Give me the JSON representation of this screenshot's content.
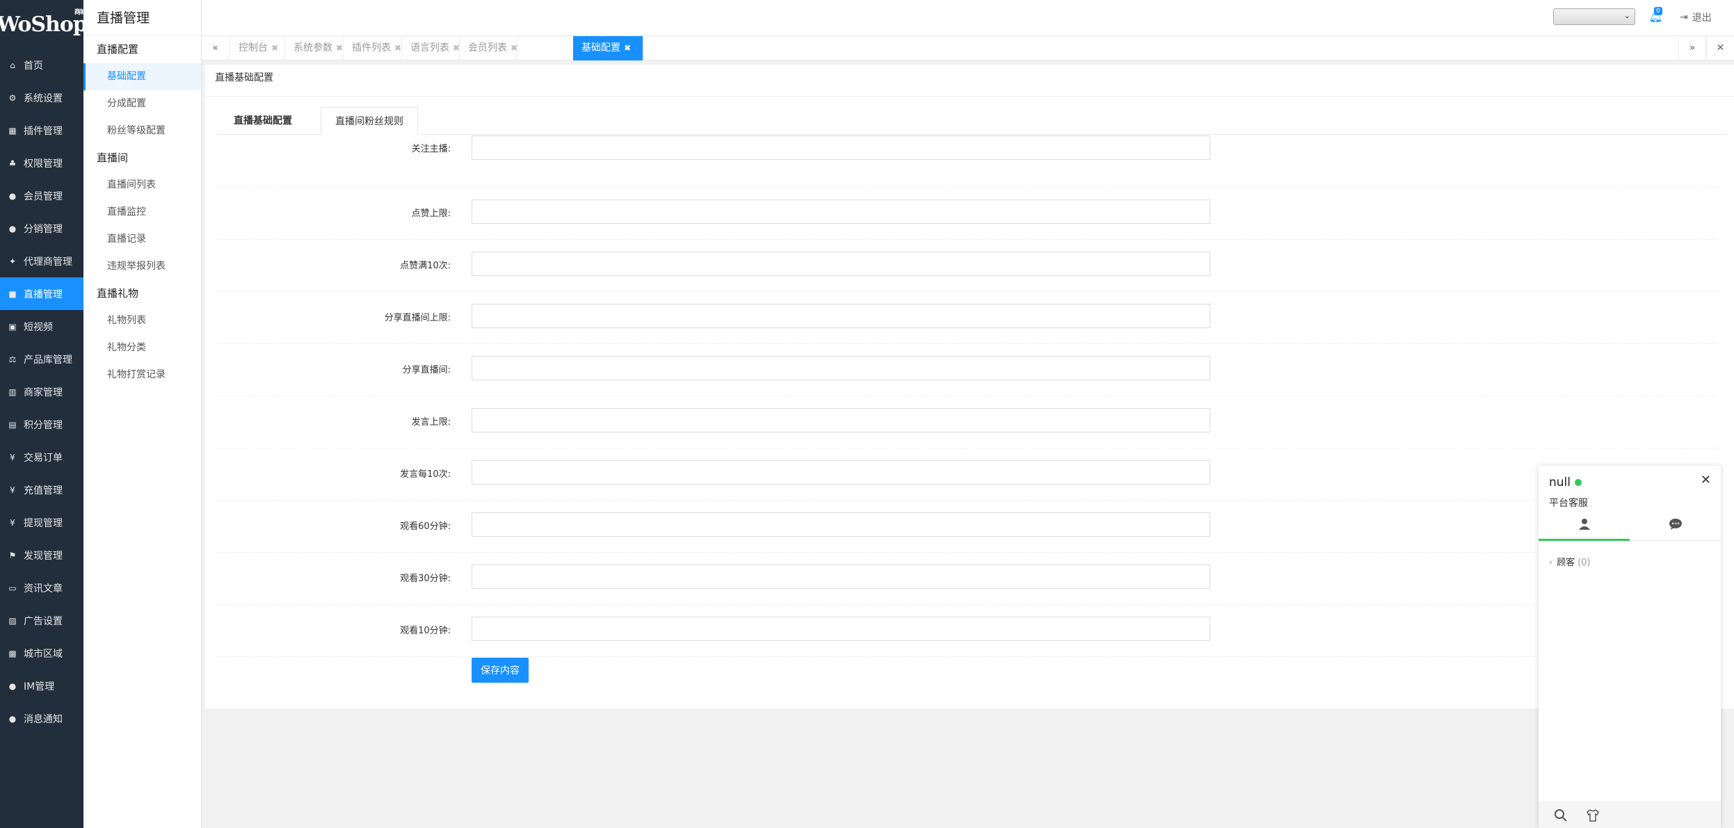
{
  "logo": {
    "text": "WoShop",
    "sup": "商城"
  },
  "nav": [
    {
      "label": "首页",
      "icon": "home-icon",
      "glyph": "⌂"
    },
    {
      "label": "系统设置",
      "icon": "gear-icon",
      "glyph": "⚙"
    },
    {
      "label": "插件管理",
      "icon": "plugin-icon",
      "glyph": "▦"
    },
    {
      "label": "权限管理",
      "icon": "sitemap-icon",
      "glyph": "♣"
    },
    {
      "label": "会员管理",
      "icon": "users-icon",
      "glyph": "●"
    },
    {
      "label": "分销管理",
      "icon": "users-icon",
      "glyph": "●"
    },
    {
      "label": "代理商管理",
      "icon": "handshake-icon",
      "glyph": "✦"
    },
    {
      "label": "直播管理",
      "icon": "video-icon",
      "glyph": "■",
      "active": true
    },
    {
      "label": "短视频",
      "icon": "file-video-icon",
      "glyph": "▣"
    },
    {
      "label": "产品库管理",
      "icon": "balance-icon",
      "glyph": "⚖"
    },
    {
      "label": "商家管理",
      "icon": "bank-icon",
      "glyph": "▥"
    },
    {
      "label": "积分管理",
      "icon": "document-icon",
      "glyph": "▤"
    },
    {
      "label": "交易订单",
      "icon": "money-icon",
      "glyph": "¥"
    },
    {
      "label": "充值管理",
      "icon": "yen-icon",
      "glyph": "¥"
    },
    {
      "label": "提现管理",
      "icon": "yen-icon",
      "glyph": "¥"
    },
    {
      "label": "发现管理",
      "icon": "flag-icon",
      "glyph": "⚑"
    },
    {
      "label": "资讯文章",
      "icon": "newspaper-icon",
      "glyph": "▭"
    },
    {
      "label": "广告设置",
      "icon": "image-icon",
      "glyph": "▨"
    },
    {
      "label": "城市区域",
      "icon": "map-icon",
      "glyph": "▩"
    },
    {
      "label": "IM管理",
      "icon": "comments-icon",
      "glyph": "●"
    },
    {
      "label": "消息通知",
      "icon": "comment-icon",
      "glyph": "●"
    }
  ],
  "subnav": {
    "title": "直播管理",
    "groups": [
      {
        "label": "直播配置",
        "items": [
          {
            "label": "基础配置",
            "active": true
          },
          {
            "label": "分成配置"
          },
          {
            "label": "粉丝等级配置"
          }
        ]
      },
      {
        "label": "直播间",
        "items": [
          {
            "label": "直播间列表"
          },
          {
            "label": "直播监控"
          },
          {
            "label": "直播记录"
          },
          {
            "label": "违规举报列表"
          }
        ]
      },
      {
        "label": "直播礼物",
        "items": [
          {
            "label": "礼物列表"
          },
          {
            "label": "礼物分类"
          },
          {
            "label": "礼物打赏记录"
          }
        ]
      }
    ]
  },
  "header": {
    "select_value": "",
    "notification_count": "0",
    "logout_label": "退出"
  },
  "tabs": [
    {
      "label": "控制台"
    },
    {
      "label": "系统参数"
    },
    {
      "label": "插件列表"
    },
    {
      "label": "语言列表"
    },
    {
      "label": "会员列表"
    },
    {
      "label": "基础配置",
      "active": true
    }
  ],
  "breadcrumb": "直播基础配置",
  "subtabs": [
    {
      "label": "直播基础配置"
    },
    {
      "label": "直播间粉丝规则",
      "active": true
    }
  ],
  "form": {
    "fields": [
      {
        "label": "关注主播:",
        "value": ""
      },
      {
        "label": "点赞上限:",
        "value": ""
      },
      {
        "label": "点赞满10次:",
        "value": ""
      },
      {
        "label": "分享直播间上限:",
        "value": ""
      },
      {
        "label": "分享直播间:",
        "value": ""
      },
      {
        "label": "发言上限:",
        "value": ""
      },
      {
        "label": "发言每10次:",
        "value": ""
      },
      {
        "label": "观看60分钟:",
        "value": ""
      },
      {
        "label": "观看30分钟:",
        "value": ""
      },
      {
        "label": "观看10分钟:",
        "value": ""
      }
    ],
    "save_label": "保存内容"
  },
  "chat": {
    "name": "null",
    "role": "平台客服",
    "visitor_label": "顾客",
    "visitor_count": "(0)"
  },
  "colors": {
    "accent": "#1890ff",
    "nav_bg": "#222e3c",
    "online": "#34c759"
  }
}
